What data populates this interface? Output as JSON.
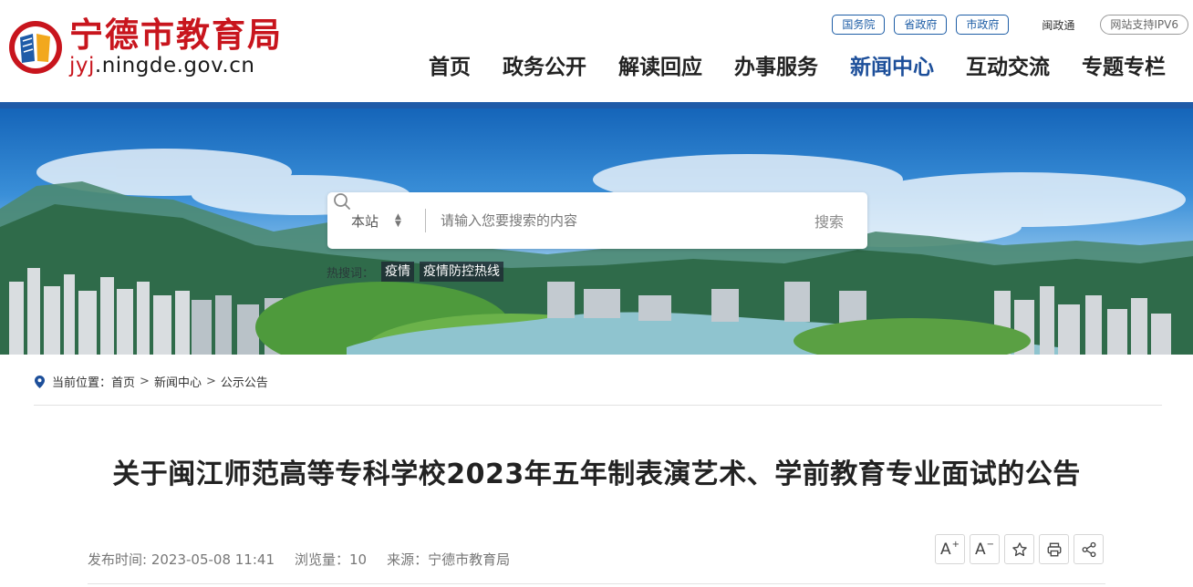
{
  "header": {
    "logo_title": "宁德市教育局",
    "logo_domain_prefix": "jyj",
    "logo_domain_rest": ".ningde.gov.cn",
    "top_links": [
      "国务院",
      "省政府",
      "市政府"
    ],
    "min_zheng_tong": "闽政通",
    "ipv6": "网站支持IPV6",
    "nav": [
      "首页",
      "政务公开",
      "解读回应",
      "办事服务",
      "新闻中心",
      "互动交流",
      "专题专栏"
    ],
    "nav_active": "新闻中心",
    "colors": {
      "brand_red": "#c8151d",
      "brand_blue": "#1f5ba8"
    }
  },
  "search": {
    "scope": "本站",
    "placeholder": "请输入您要搜索的内容",
    "button": "搜索",
    "hot_label": "热搜词：",
    "hot_tags": [
      "疫情",
      "疫情防控热线"
    ]
  },
  "breadcrumb": {
    "prefix": "当前位置：",
    "items": [
      "首页",
      "新闻中心",
      "公示公告"
    ],
    "separator": ">"
  },
  "article": {
    "title": "关于闽江师范高等专科学校2023年五年制表演艺术、学前教育专业面试的公告",
    "publish_time": "发布时间: 2023-05-08 11:41",
    "views": "浏览量：10",
    "source": "来源：宁德市教育局"
  },
  "tools": {
    "font_larger": "A",
    "font_smaller": "A",
    "plus": "+",
    "minus": "−"
  }
}
